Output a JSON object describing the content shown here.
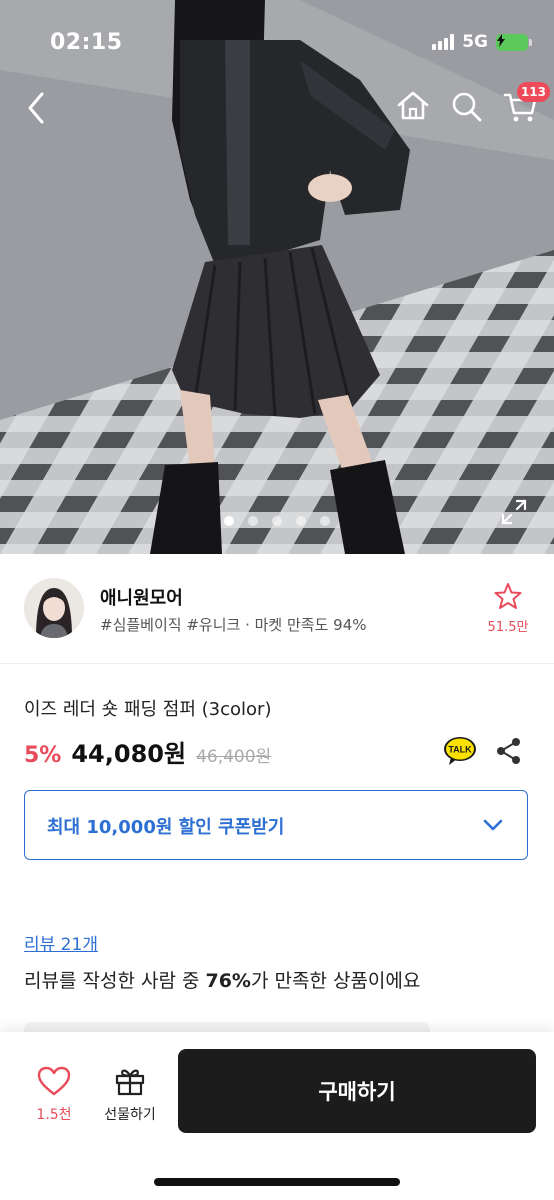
{
  "status_bar": {
    "time": "02:15",
    "network": "5G"
  },
  "header": {
    "cart_badge": "113"
  },
  "gallery": {
    "image_count": 5,
    "active_index": 0
  },
  "seller": {
    "name": "애니원모어",
    "tags": "#심플베이직 #유니크 · 마켓 만족도 94%",
    "wish_count": "51.5만"
  },
  "product": {
    "name": "이즈 레더 숏 패딩 점퍼 (3color)",
    "discount": "5%",
    "price": "44,080원",
    "original_price": "46,400원"
  },
  "coupon": {
    "label": "최대 10,000원 할인 쿠폰받기"
  },
  "reviews": {
    "link": "리뷰 21개",
    "summary_before": "리뷰를 작성한 사람 중 ",
    "summary_highlight": "76%",
    "summary_after": "가 만족한 상품이에요"
  },
  "bottom_bar": {
    "like_count": "1.5천",
    "gift_label": "선물하기",
    "buy_label": "구매하기"
  },
  "colors": {
    "accent_red": "#e84c5a",
    "link_blue": "#2d6fd3",
    "buy_button": "#1c1c1c",
    "talk_yellow": "#fae100"
  }
}
